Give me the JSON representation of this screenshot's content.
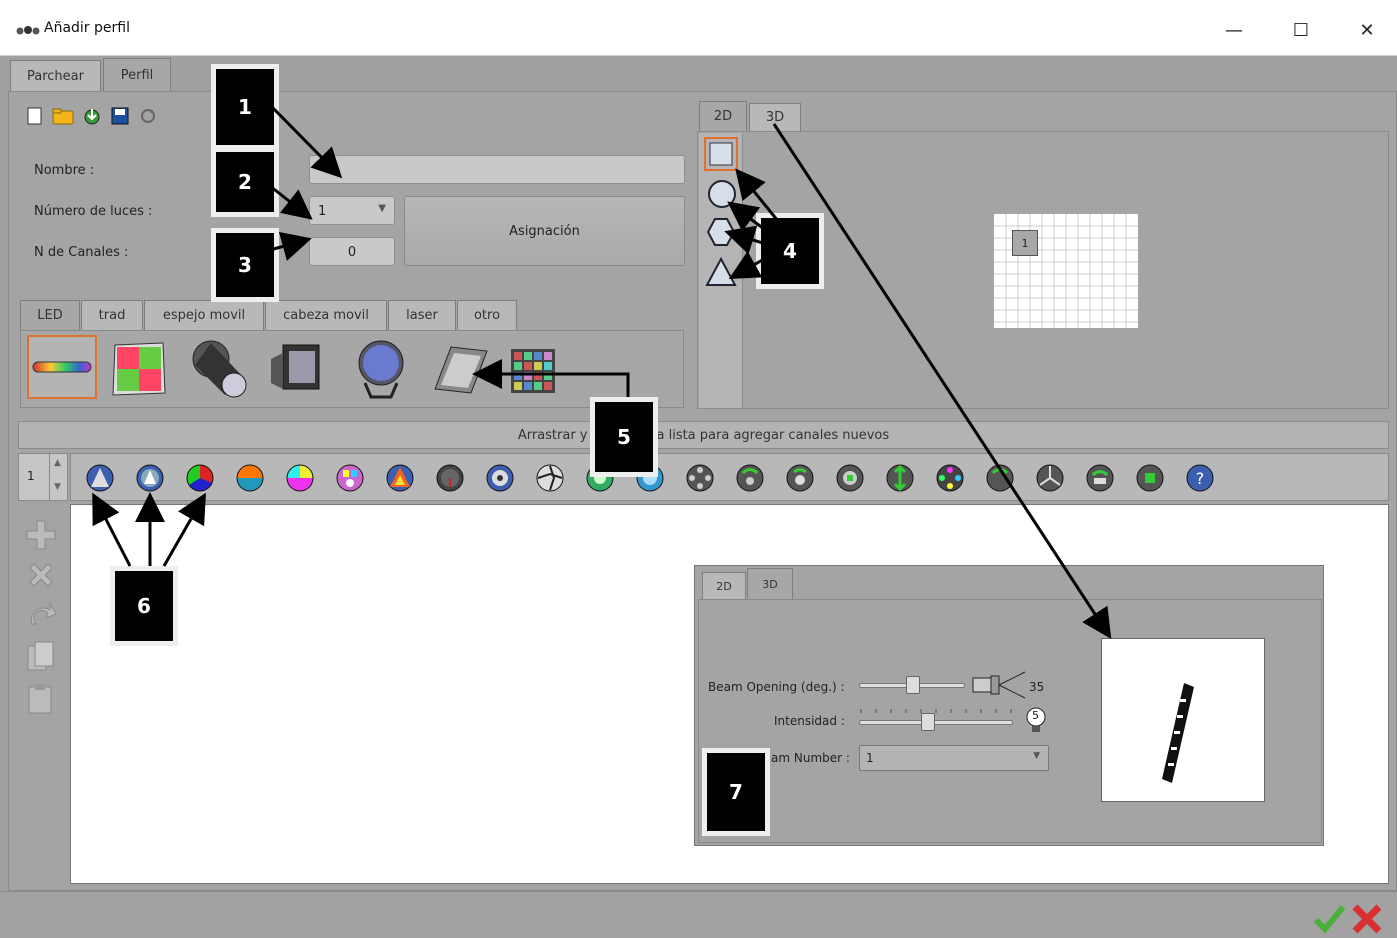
{
  "window": {
    "title": "Añadir perfil",
    "minimize": "—",
    "maximize": "☐",
    "close": "✕"
  },
  "main_tabs": [
    {
      "label": "Parchear"
    },
    {
      "label": "Perfil"
    }
  ],
  "form": {
    "nombre_label": "Nombre :",
    "nombre_value": "",
    "luces_label": "Número de luces :",
    "luces_value": "1",
    "canales_label": "N de Canales  :",
    "canales_value": "0",
    "asignacion_button": "Asignación"
  },
  "category_tabs": [
    {
      "label": "LED"
    },
    {
      "label": "trad"
    },
    {
      "label": "espejo movil"
    },
    {
      "label": "cabeza movil"
    },
    {
      "label": "laser"
    },
    {
      "label": "otro"
    }
  ],
  "view_tabs": [
    {
      "label": "2D"
    },
    {
      "label": "3D"
    }
  ],
  "grid_cell_label": "1",
  "drag_hint": "Arrastrar y soltar en la lista para agregar canales nuevos",
  "channel_spinner_value": "1",
  "inset": {
    "tabs": [
      {
        "label": "2D"
      },
      {
        "label": "3D"
      }
    ],
    "beam_opening_label": "Beam Opening (deg.) :",
    "beam_opening_value": "35",
    "beam_opening_level": 0.42,
    "intensidad_label": "Intensidad :",
    "intensidad_value": "5",
    "intensidad_level": 0.45,
    "beam_number_label": "am Number :",
    "beam_number_value": "1"
  },
  "callouts": [
    "1",
    "2",
    "3",
    "4",
    "5",
    "6",
    "7"
  ],
  "footer": {
    "ok_icon": "check-icon",
    "cancel_icon": "cross-icon"
  },
  "colors": {
    "accent_selected": "#e07030",
    "panel": "#a4a4a4",
    "workspace": "#ffffff",
    "ok": "#4caf3a",
    "cancel": "#d83030"
  }
}
